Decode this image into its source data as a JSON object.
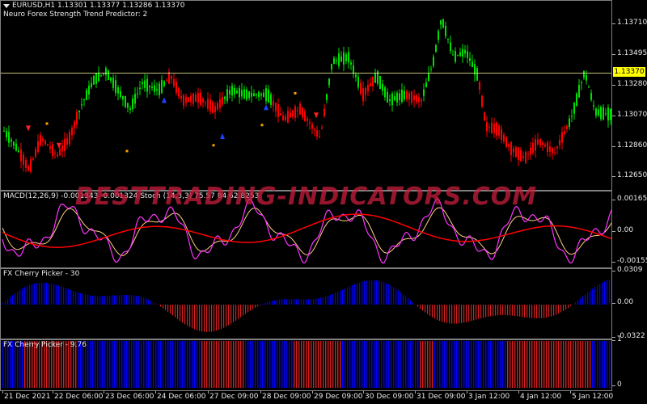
{
  "main": {
    "symbol_info": "EURUSD,H1  1.13301 1.13377 1.13286 1.13370",
    "indicator_name": "Neuro Forex Strength Trend Predictor: 2",
    "price_ticks": [
      {
        "label": "1.13710",
        "value": 1.1371
      },
      {
        "label": "1.13495",
        "value": 1.13495
      },
      {
        "label": "1.13280",
        "value": 1.1328
      },
      {
        "label": "1.13070",
        "value": 1.1307
      },
      {
        "label": "1.12860",
        "value": 1.1286
      },
      {
        "label": "1.12650",
        "value": 1.1265
      }
    ],
    "current_price": "1.13370",
    "current_price_value": 1.1337
  },
  "macd": {
    "title": "MACD(12,26,9) -0.001343 -0.001324",
    "stoch_title": "Stoch (14,3,3) 75.57 84 62.8253",
    "ticks": [
      {
        "label": "0.001654",
        "value": 0.001654
      },
      {
        "label": "0.00",
        "value": 0
      },
      {
        "label": "-0.00155",
        "value": -0.00155
      }
    ]
  },
  "cherry1": {
    "title": "FX Cherry Picker - 30",
    "ticks": [
      {
        "label": "0.0309",
        "value": 0.0309
      },
      {
        "label": "0.00",
        "value": 0
      },
      {
        "label": "-0.0322",
        "value": -0.0322
      }
    ]
  },
  "cherry2": {
    "title": "FX Cherry Picker - 9.76",
    "ticks": [
      {
        "label": "1",
        "value": 1
      },
      {
        "label": "0",
        "value": 0
      }
    ]
  },
  "time_axis": [
    "21 Dec 2021",
    "22 Dec 06:00",
    "23 Dec 06:00",
    "24 Dec 06:00",
    "27 Dec 09:00",
    "28 Dec 09:00",
    "29 Dec 09:00",
    "30 Dec 09:00",
    "31 Dec 09:00",
    "3 Jan 12:00",
    "4 Jan 12:00",
    "5 Jan 12:00"
  ],
  "watermark": "BESTTRADING-INDICATORS.COM",
  "colors": {
    "bull": "#00e000",
    "bear": "#ff0000",
    "hist_pos": "#0000ff",
    "hist_neg": "#d42020",
    "stoch_line": "#ff33ff",
    "signal_line": "#ff0000",
    "macd_line": "#ffd080",
    "price_line": "#ffff00"
  }
}
